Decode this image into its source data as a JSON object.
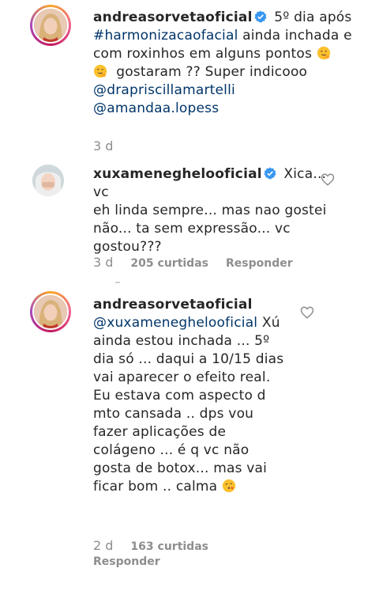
{
  "comments": [
    {
      "username": "andreasorvetaoficial",
      "text_1": "5º dia após",
      "hashtag": "#harmonizacaofacial",
      "text_2": "ainda inchada e",
      "text_3": "com roxinhos em alguns pontos",
      "text_4": "gostaram ?? Super indicooo",
      "mention_1": "@drapriscillamartelli",
      "mention_2": "@amandaa.lopess",
      "time": "3 d"
    },
    {
      "username": "xuxameneghelooficial",
      "text_l1": "Xica... vc",
      "text_l2": "eh linda sempre... mas nao gostei",
      "text_l3": "não... ta sem expressão... vc",
      "text_l4": "gostou???",
      "time": "3 d",
      "likes": "205 curtidas",
      "reply": "Responder"
    },
    {
      "username": "andreasorvetaoficial",
      "mention": "@xuxameneghelooficial",
      "lines": [
        "Xú",
        "ainda estou inchada ... 5º",
        "dia só ... daqui a 10/15 dias",
        "vai aparecer o efeito real.",
        "Eu estava com aspecto d",
        "mto cansada .. dps vou",
        "fazer aplicações de",
        "colágeno ... é q vc não",
        "gosta de botox... mas vai",
        "ficar bom .. calma"
      ],
      "time": "2 d",
      "likes": "163 curtidas",
      "reply": "Responder"
    }
  ],
  "icons": {
    "verified": "verified-badge-icon",
    "heart": "heart-outline-icon",
    "emoji_smile": "smiling-face-hand-icon",
    "emoji_kiss": "kissing-face-icon"
  },
  "colors": {
    "link": "#003569",
    "muted": "#8e8e8e",
    "verified": "#3897f0"
  }
}
